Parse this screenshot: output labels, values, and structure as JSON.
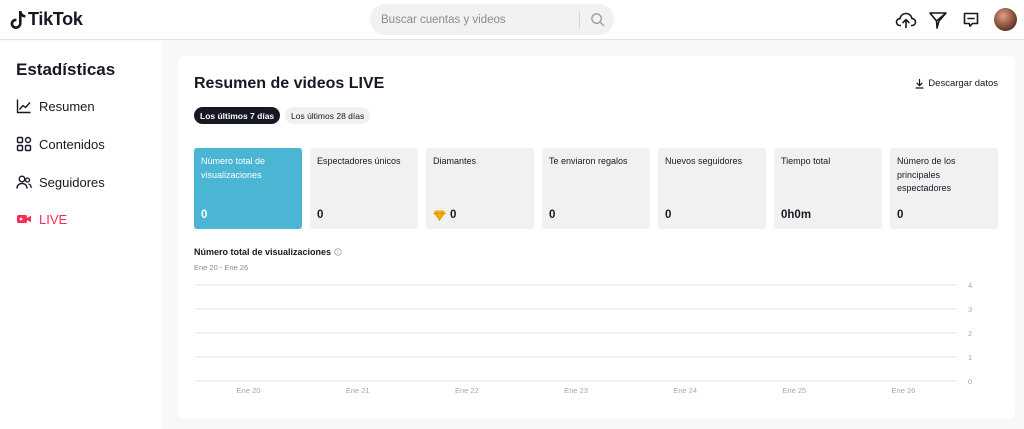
{
  "header": {
    "logo_text": "TikTok",
    "search": {
      "placeholder": "Buscar cuentas y videos"
    },
    "icons": [
      "upload-cloud-icon",
      "send-filter-icon",
      "inbox-icon",
      "avatar"
    ]
  },
  "sidebar": {
    "title": "Estadísticas",
    "items": [
      {
        "label": "Resumen",
        "icon": "chart-line-icon"
      },
      {
        "label": "Contenidos",
        "icon": "grid-icon"
      },
      {
        "label": "Seguidores",
        "icon": "people-icon"
      },
      {
        "label": "LIVE",
        "icon": "live-camera-icon",
        "active": true
      }
    ]
  },
  "main": {
    "title": "Resumen de videos LIVE",
    "download_label": "Descargar datos",
    "ranges": [
      "Los últimos 7 días",
      "Los últimos 28 días"
    ],
    "selected_range": "Los últimos 7 días",
    "metrics": [
      {
        "label": "Número total de visualizaciones",
        "value": "0"
      },
      {
        "label": "Espectadores únicos",
        "value": "0"
      },
      {
        "label": "Diamantes",
        "value": "0"
      },
      {
        "label": "Te enviaron regalos",
        "value": "0"
      },
      {
        "label": "Nuevos seguidores",
        "value": "0"
      },
      {
        "label": "Tiempo total",
        "value": "0h0m"
      },
      {
        "label": "Número de los principales espectadores",
        "value": "0"
      }
    ],
    "chart_heading": "Número total de visualizaciones",
    "chart_range": "Ene 20 - Ene 26"
  },
  "colors": {
    "accent": "#fe2c55",
    "active_metric": "#4ab6d4",
    "text": "#161823",
    "muted": "#8a8b91"
  },
  "chart_data": {
    "type": "line",
    "title": "Número total de visualizaciones",
    "subtitle": "Ene 20 - Ene 26",
    "categories": [
      "Ene 20",
      "Ene 21",
      "Ene 22",
      "Ene 23",
      "Ene 24",
      "Ene 25",
      "Ene 26"
    ],
    "series": [
      {
        "values": [
          0,
          0,
          0,
          0,
          0,
          0,
          0
        ]
      }
    ],
    "yticks": [
      "0",
      "1",
      "2",
      "3",
      "4"
    ],
    "ylim": [
      0,
      4
    ],
    "grid": true,
    "y_axis_side": "right"
  }
}
